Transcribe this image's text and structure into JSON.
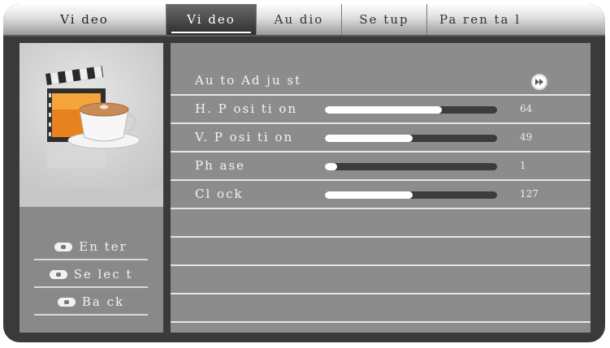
{
  "header": {
    "title": "Vi deo",
    "tabs": [
      {
        "label": "Vi deo",
        "active": true
      },
      {
        "label": "Au dio",
        "active": false
      },
      {
        "label": "Se tup",
        "active": false
      },
      {
        "label": "Pa ren ta l",
        "active": false
      }
    ]
  },
  "art": {
    "icon": "video-clapboard-coffee-icon"
  },
  "help": [
    {
      "icon": "enter-key-icon",
      "label": "En ter"
    },
    {
      "icon": "dpad-icon",
      "label": "Se lec t"
    },
    {
      "icon": "exit-key-icon",
      "label": "Ba ck"
    }
  ],
  "menu": {
    "auto_adjust": {
      "label": "Au to Ad ju st",
      "icon": "fast-forward-icon"
    },
    "items": [
      {
        "label": "H. P osi ti on",
        "value": "64",
        "level": 0.68
      },
      {
        "label": "V. P osi ti on",
        "value": "49",
        "level": 0.51
      },
      {
        "label": "Ph ase",
        "value": "1",
        "level": 0.07
      },
      {
        "label": "Cl ock",
        "value": "127",
        "level": 0.51
      }
    ]
  }
}
